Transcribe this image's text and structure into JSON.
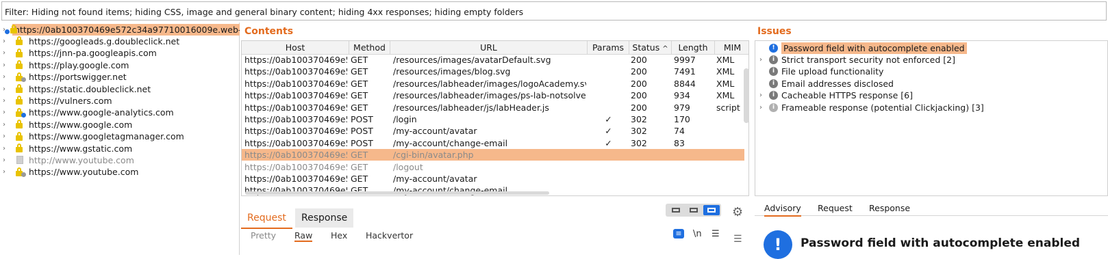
{
  "filter": "Filter: Hiding not found items;  hiding CSS, image and general binary content;  hiding 4xx responses;  hiding empty folders",
  "site_tree": [
    {
      "label": "https://0ab100370469e572c34a97710016009e.web-s",
      "icon": "lock-icon",
      "badge": "blue",
      "selected": true
    },
    {
      "label": "https://googleads.g.doubleclick.net",
      "icon": "lock-icon"
    },
    {
      "label": "https://jnn-pa.googleapis.com",
      "icon": "lock-icon"
    },
    {
      "label": "https://play.google.com",
      "icon": "lock-icon"
    },
    {
      "label": "https://portswigger.net",
      "icon": "lock-icon",
      "badge": "grey"
    },
    {
      "label": "https://static.doubleclick.net",
      "icon": "lock-icon"
    },
    {
      "label": "https://vulners.com",
      "icon": "lock-icon"
    },
    {
      "label": "https://www.google-analytics.com",
      "icon": "lock-icon",
      "badge": "blue"
    },
    {
      "label": "https://www.google.com",
      "icon": "lock-icon"
    },
    {
      "label": "https://www.googletagmanager.com",
      "icon": "lock-icon"
    },
    {
      "label": "https://www.gstatic.com",
      "icon": "lock-icon"
    },
    {
      "label": "http://www.youtube.com",
      "icon": "file-icon",
      "dimmed": true
    },
    {
      "label": "https://www.youtube.com",
      "icon": "lock-icon",
      "badge": "grey"
    }
  ],
  "contents": {
    "title": "Contents",
    "columns": [
      "Host",
      "Method",
      "URL",
      "Params",
      "Status",
      "Length",
      "MIM"
    ],
    "sort_indicator": "^",
    "rows": [
      {
        "host": "https://0ab100370469e5...",
        "method": "GET",
        "url": "/resources/images/avatarDefault.svg",
        "params": "",
        "status": "200",
        "length": "9997",
        "mime": "XML"
      },
      {
        "host": "https://0ab100370469e5...",
        "method": "GET",
        "url": "/resources/images/blog.svg",
        "params": "",
        "status": "200",
        "length": "7491",
        "mime": "XML"
      },
      {
        "host": "https://0ab100370469e5...",
        "method": "GET",
        "url": "/resources/labheader/images/logoAcademy.svg",
        "params": "",
        "status": "200",
        "length": "8844",
        "mime": "XML"
      },
      {
        "host": "https://0ab100370469e5...",
        "method": "GET",
        "url": "/resources/labheader/images/ps-lab-notsolved.s...",
        "params": "",
        "status": "200",
        "length": "934",
        "mime": "XML"
      },
      {
        "host": "https://0ab100370469e5...",
        "method": "GET",
        "url": "/resources/labheader/js/labHeader.js",
        "params": "",
        "status": "200",
        "length": "979",
        "mime": "script"
      },
      {
        "host": "https://0ab100370469e5...",
        "method": "POST",
        "url": "/login",
        "params": "✓",
        "status": "302",
        "length": "170",
        "mime": ""
      },
      {
        "host": "https://0ab100370469e5...",
        "method": "POST",
        "url": "/my-account/avatar",
        "params": "✓",
        "status": "302",
        "length": "74",
        "mime": ""
      },
      {
        "host": "https://0ab100370469e5...",
        "method": "POST",
        "url": "/my-account/change-email",
        "params": "✓",
        "status": "302",
        "length": "83",
        "mime": ""
      },
      {
        "host": "https://0ab100370469e5...",
        "method": "GET",
        "url": "/cgi-bin/avatar.php",
        "params": "",
        "status": "",
        "length": "",
        "mime": "",
        "highlight": true,
        "dimmed": true
      },
      {
        "host": "https://0ab100370469e5...",
        "method": "GET",
        "url": "/logout",
        "params": "",
        "status": "",
        "length": "",
        "mime": "",
        "dimmed": true
      },
      {
        "host": "https://0ab100370469e5...",
        "method": "GET",
        "url": "/my-account/avatar",
        "params": "",
        "status": "",
        "length": "",
        "mime": ""
      },
      {
        "host": "https://0ab100370469e5...",
        "method": "GET",
        "url": "/my-account/change-email",
        "params": "",
        "status": "",
        "length": "",
        "mime": ""
      }
    ]
  },
  "request_tabs": {
    "request": "Request",
    "response": "Response"
  },
  "subtabs": {
    "pretty": "Pretty",
    "raw": "Raw",
    "hex": "Hex",
    "hackvertor": "Hackvertor",
    "newline": "\\n"
  },
  "issues": {
    "title": "Issues",
    "items": [
      {
        "label": "Password field with autocomplete enabled",
        "expandable": false,
        "severity": "blue",
        "selected": true
      },
      {
        "label": "Strict transport security not enforced [2]",
        "expandable": true,
        "severity": "grey"
      },
      {
        "label": "File upload functionality",
        "expandable": false,
        "severity": "grey"
      },
      {
        "label": "Email addresses disclosed",
        "expandable": false,
        "severity": "grey"
      },
      {
        "label": "Cacheable HTTPS response [6]",
        "expandable": true,
        "severity": "grey"
      },
      {
        "label": "Frameable response (potential Clickjacking) [3]",
        "expandable": true,
        "severity": "light"
      }
    ]
  },
  "advisory": {
    "tabs": [
      "Advisory",
      "Request",
      "Response"
    ],
    "heading": "Password field with autocomplete enabled"
  }
}
